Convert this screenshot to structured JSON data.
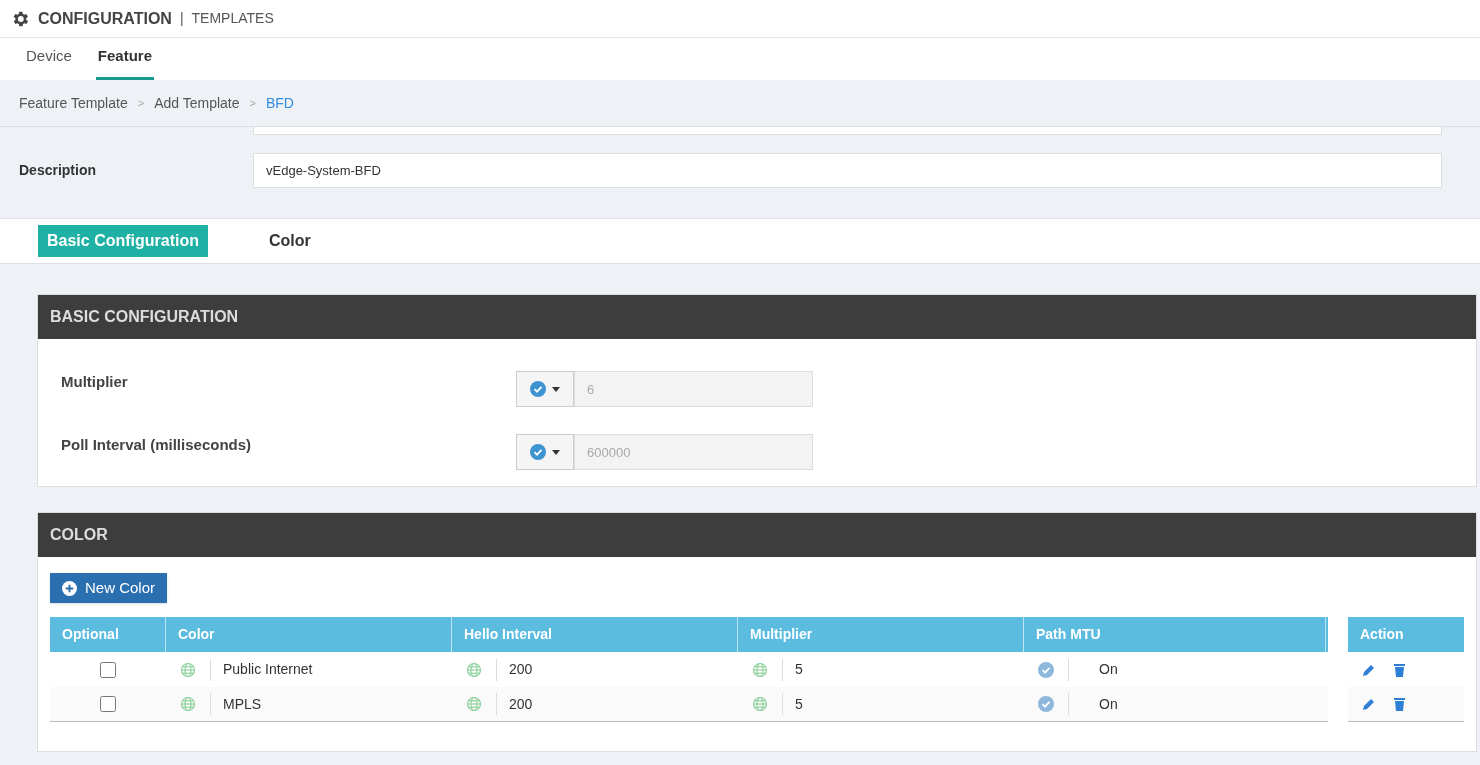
{
  "header": {
    "title": "CONFIGURATION",
    "separator": "|",
    "subtitle": "TEMPLATES"
  },
  "tabs": [
    {
      "label": "Device",
      "selected": false
    },
    {
      "label": "Feature",
      "selected": true
    }
  ],
  "breadcrumb": [
    {
      "label": "Feature Template",
      "current": false
    },
    {
      "label": "Add Template",
      "current": false
    },
    {
      "label": "BFD",
      "current": true
    }
  ],
  "breadcrumb_separator": ">",
  "form": {
    "description_label": "Description",
    "description_value": "vEdge-System-BFD"
  },
  "section_tabs": [
    {
      "label": "Basic Configuration",
      "selected": true
    },
    {
      "label": "Color",
      "selected": false
    }
  ],
  "basic_configuration": {
    "title": "BASIC CONFIGURATION",
    "fields": [
      {
        "label": "Multiplier",
        "kind": "check",
        "placeholder": "6"
      },
      {
        "label": "Poll Interval (milliseconds)",
        "kind": "check",
        "placeholder": "600000"
      }
    ]
  },
  "color_section": {
    "title": "COLOR",
    "new_button": "New Color",
    "columns": [
      "Optional",
      "Color",
      "Hello Interval",
      "Multiplier",
      "Path MTU",
      "Action"
    ],
    "rows": [
      {
        "cells": [
          {
            "kind": "checkbox",
            "checked": false
          },
          {
            "kind": "global",
            "value": "Public Internet"
          },
          {
            "kind": "global",
            "value": "200"
          },
          {
            "kind": "global",
            "value": "5"
          },
          {
            "kind": "check",
            "value": "On"
          }
        ]
      },
      {
        "cells": [
          {
            "kind": "checkbox",
            "checked": false
          },
          {
            "kind": "global",
            "value": "MPLS"
          },
          {
            "kind": "global",
            "value": "200"
          },
          {
            "kind": "global",
            "value": "5"
          },
          {
            "kind": "check",
            "value": "On"
          }
        ]
      }
    ]
  }
}
